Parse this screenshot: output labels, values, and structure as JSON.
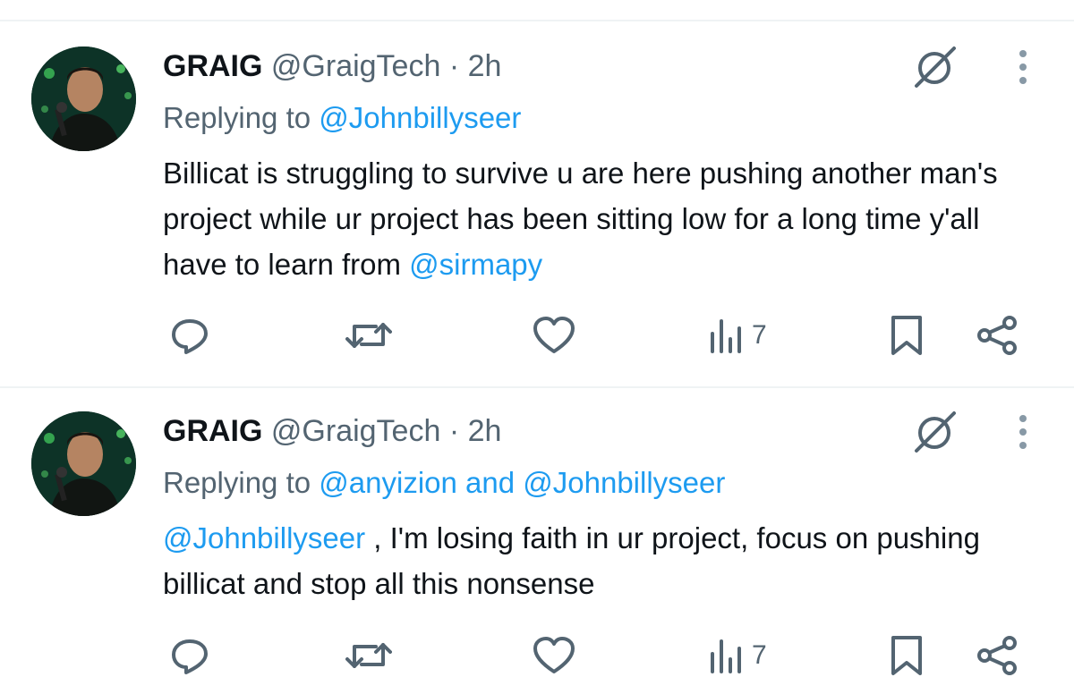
{
  "tweets": [
    {
      "name": "GRAIG",
      "handle": "@GraigTech",
      "separator": "·",
      "time": "2h",
      "replying_prefix": "Replying to",
      "reply_to_1": "@Johnbillyseer",
      "reply_joiner": "",
      "reply_to_2": "",
      "text_before": "Billicat is struggling to survive u are here pushing another man's project while ur project has been sitting low for a long time y'all have to learn from ",
      "text_mention": "@sirmapy",
      "text_after": "",
      "views": "7"
    },
    {
      "name": "GRAIG",
      "handle": "@GraigTech",
      "separator": "·",
      "time": "2h",
      "replying_prefix": "Replying to",
      "reply_to_1": "@anyizion",
      "reply_joiner": "and",
      "reply_to_2": "@Johnbillyseer",
      "text_before": "",
      "text_mention": "@Johnbillyseer",
      "text_after": " , I'm losing faith in ur project, focus on pushing billicat and stop all this nonsense",
      "views": "7"
    }
  ],
  "icons": {
    "reply": "reply-icon",
    "retweet": "retweet-icon",
    "like": "heart-icon",
    "views": "views-icon",
    "bookmark": "bookmark-icon",
    "share": "share-icon",
    "grok": "grok-icon",
    "more": "more-icon"
  },
  "colors": {
    "link": "#1d9bf0",
    "secondary": "#536471",
    "text": "#0f1419",
    "divider": "#eff3f4"
  }
}
